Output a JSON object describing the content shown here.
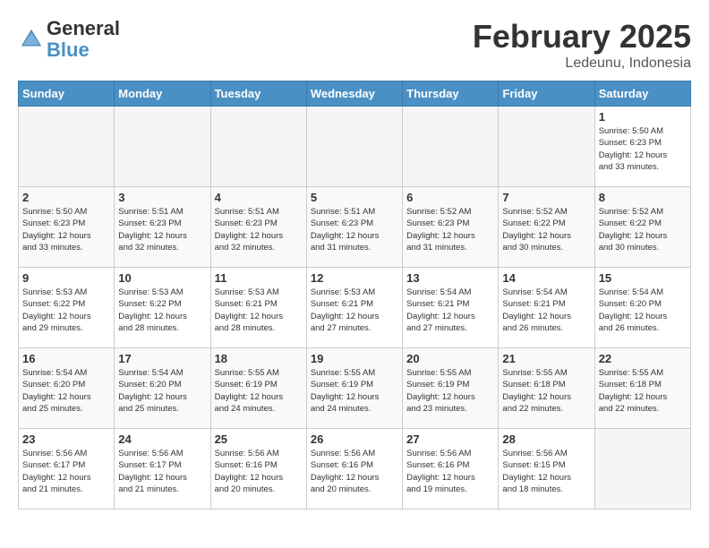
{
  "header": {
    "logo_general": "General",
    "logo_blue": "Blue",
    "month_title": "February 2025",
    "location": "Ledeunu, Indonesia"
  },
  "weekdays": [
    "Sunday",
    "Monday",
    "Tuesday",
    "Wednesday",
    "Thursday",
    "Friday",
    "Saturday"
  ],
  "weeks": [
    [
      {
        "day": "",
        "info": ""
      },
      {
        "day": "",
        "info": ""
      },
      {
        "day": "",
        "info": ""
      },
      {
        "day": "",
        "info": ""
      },
      {
        "day": "",
        "info": ""
      },
      {
        "day": "",
        "info": ""
      },
      {
        "day": "1",
        "info": "Sunrise: 5:50 AM\nSunset: 6:23 PM\nDaylight: 12 hours\nand 33 minutes."
      }
    ],
    [
      {
        "day": "2",
        "info": "Sunrise: 5:50 AM\nSunset: 6:23 PM\nDaylight: 12 hours\nand 33 minutes."
      },
      {
        "day": "3",
        "info": "Sunrise: 5:51 AM\nSunset: 6:23 PM\nDaylight: 12 hours\nand 32 minutes."
      },
      {
        "day": "4",
        "info": "Sunrise: 5:51 AM\nSunset: 6:23 PM\nDaylight: 12 hours\nand 32 minutes."
      },
      {
        "day": "5",
        "info": "Sunrise: 5:51 AM\nSunset: 6:23 PM\nDaylight: 12 hours\nand 31 minutes."
      },
      {
        "day": "6",
        "info": "Sunrise: 5:52 AM\nSunset: 6:23 PM\nDaylight: 12 hours\nand 31 minutes."
      },
      {
        "day": "7",
        "info": "Sunrise: 5:52 AM\nSunset: 6:22 PM\nDaylight: 12 hours\nand 30 minutes."
      },
      {
        "day": "8",
        "info": "Sunrise: 5:52 AM\nSunset: 6:22 PM\nDaylight: 12 hours\nand 30 minutes."
      }
    ],
    [
      {
        "day": "9",
        "info": "Sunrise: 5:53 AM\nSunset: 6:22 PM\nDaylight: 12 hours\nand 29 minutes."
      },
      {
        "day": "10",
        "info": "Sunrise: 5:53 AM\nSunset: 6:22 PM\nDaylight: 12 hours\nand 28 minutes."
      },
      {
        "day": "11",
        "info": "Sunrise: 5:53 AM\nSunset: 6:21 PM\nDaylight: 12 hours\nand 28 minutes."
      },
      {
        "day": "12",
        "info": "Sunrise: 5:53 AM\nSunset: 6:21 PM\nDaylight: 12 hours\nand 27 minutes."
      },
      {
        "day": "13",
        "info": "Sunrise: 5:54 AM\nSunset: 6:21 PM\nDaylight: 12 hours\nand 27 minutes."
      },
      {
        "day": "14",
        "info": "Sunrise: 5:54 AM\nSunset: 6:21 PM\nDaylight: 12 hours\nand 26 minutes."
      },
      {
        "day": "15",
        "info": "Sunrise: 5:54 AM\nSunset: 6:20 PM\nDaylight: 12 hours\nand 26 minutes."
      }
    ],
    [
      {
        "day": "16",
        "info": "Sunrise: 5:54 AM\nSunset: 6:20 PM\nDaylight: 12 hours\nand 25 minutes."
      },
      {
        "day": "17",
        "info": "Sunrise: 5:54 AM\nSunset: 6:20 PM\nDaylight: 12 hours\nand 25 minutes."
      },
      {
        "day": "18",
        "info": "Sunrise: 5:55 AM\nSunset: 6:19 PM\nDaylight: 12 hours\nand 24 minutes."
      },
      {
        "day": "19",
        "info": "Sunrise: 5:55 AM\nSunset: 6:19 PM\nDaylight: 12 hours\nand 24 minutes."
      },
      {
        "day": "20",
        "info": "Sunrise: 5:55 AM\nSunset: 6:19 PM\nDaylight: 12 hours\nand 23 minutes."
      },
      {
        "day": "21",
        "info": "Sunrise: 5:55 AM\nSunset: 6:18 PM\nDaylight: 12 hours\nand 22 minutes."
      },
      {
        "day": "22",
        "info": "Sunrise: 5:55 AM\nSunset: 6:18 PM\nDaylight: 12 hours\nand 22 minutes."
      }
    ],
    [
      {
        "day": "23",
        "info": "Sunrise: 5:56 AM\nSunset: 6:17 PM\nDaylight: 12 hours\nand 21 minutes."
      },
      {
        "day": "24",
        "info": "Sunrise: 5:56 AM\nSunset: 6:17 PM\nDaylight: 12 hours\nand 21 minutes."
      },
      {
        "day": "25",
        "info": "Sunrise: 5:56 AM\nSunset: 6:16 PM\nDaylight: 12 hours\nand 20 minutes."
      },
      {
        "day": "26",
        "info": "Sunrise: 5:56 AM\nSunset: 6:16 PM\nDaylight: 12 hours\nand 20 minutes."
      },
      {
        "day": "27",
        "info": "Sunrise: 5:56 AM\nSunset: 6:16 PM\nDaylight: 12 hours\nand 19 minutes."
      },
      {
        "day": "28",
        "info": "Sunrise: 5:56 AM\nSunset: 6:15 PM\nDaylight: 12 hours\nand 18 minutes."
      },
      {
        "day": "",
        "info": ""
      }
    ]
  ]
}
